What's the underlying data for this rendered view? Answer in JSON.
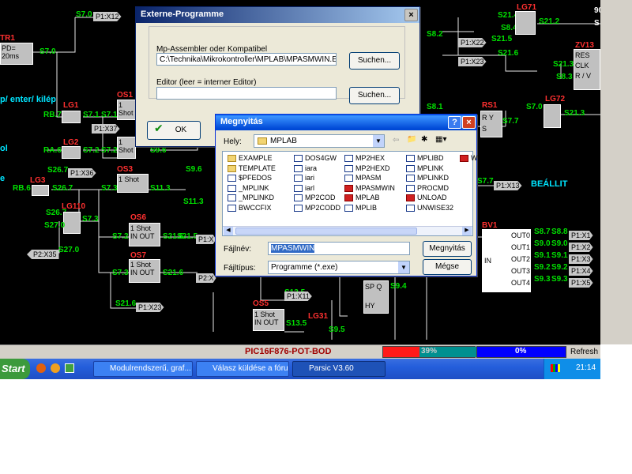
{
  "schematic": {
    "labels": [
      {
        "t": "S7.0",
        "c": "g"
      },
      {
        "t": "P1:X12",
        "c": "tag"
      },
      {
        "t": "TR1",
        "c": "r"
      },
      {
        "t": "PD=",
        "c": "k"
      },
      {
        "t": "20ms",
        "c": "k"
      },
      {
        "t": "S7.0",
        "c": "g"
      },
      {
        "t": "p/ enter/ kilép",
        "c": "c"
      },
      {
        "t": "LG1",
        "c": "r"
      },
      {
        "t": "RB.7",
        "c": "g"
      },
      {
        "t": "S7.1",
        "c": "g"
      },
      {
        "t": "OS1",
        "c": "r"
      },
      {
        "t": "S7.1",
        "c": "g"
      },
      {
        "t": "P1:X37",
        "c": "tag"
      },
      {
        "t": "ol",
        "c": "c"
      },
      {
        "t": "LG2",
        "c": "r"
      },
      {
        "t": "RA.6",
        "c": "g"
      },
      {
        "t": "S7.2",
        "c": "g"
      },
      {
        "t": "S7.2",
        "c": "g"
      },
      {
        "t": "S9.6",
        "c": "g"
      },
      {
        "t": "S26.7",
        "c": "g"
      },
      {
        "t": "P1:X36",
        "c": "tag"
      },
      {
        "t": "OS3",
        "c": "r"
      },
      {
        "t": "S9.6",
        "c": "g"
      },
      {
        "t": "e",
        "c": "c"
      },
      {
        "t": "LG3",
        "c": "r"
      },
      {
        "t": "RB.6",
        "c": "g"
      },
      {
        "t": "S26.7",
        "c": "g"
      },
      {
        "t": "S7.3",
        "c": "g"
      },
      {
        "t": "S11.3",
        "c": "g"
      },
      {
        "t": "LG110",
        "c": "r"
      },
      {
        "t": "S26.7",
        "c": "g"
      },
      {
        "t": "S7.3",
        "c": "g"
      },
      {
        "t": "S11.3",
        "c": "g"
      },
      {
        "t": "S27.0",
        "c": "g"
      },
      {
        "t": "OS6",
        "c": "r"
      },
      {
        "t": "P2:X35",
        "c": "tag"
      },
      {
        "t": "S27.0",
        "c": "g"
      },
      {
        "t": "S7.2",
        "c": "g"
      },
      {
        "t": "S21.5",
        "c": "g"
      },
      {
        "t": "S21.5",
        "c": "g"
      },
      {
        "t": "P1:X",
        "c": "tag"
      },
      {
        "t": "OS7",
        "c": "r"
      },
      {
        "t": "S7.3",
        "c": "g"
      },
      {
        "t": "S21.6",
        "c": "g"
      },
      {
        "t": "P2:X",
        "c": "tag"
      },
      {
        "t": "S21.6",
        "c": "g"
      },
      {
        "t": "P1:X23",
        "c": "tag"
      },
      {
        "t": "OS5",
        "c": "r"
      },
      {
        "t": "S13.5",
        "c": "g"
      },
      {
        "t": "P1:X11",
        "c": "tag"
      },
      {
        "t": "S13.5",
        "c": "g"
      },
      {
        "t": "LG31",
        "c": "r"
      },
      {
        "t": "S9.5",
        "c": "g"
      },
      {
        "t": "S9.4",
        "c": "g"
      },
      {
        "t": "S8.2",
        "c": "g"
      },
      {
        "t": "P1:X22",
        "c": "tag"
      },
      {
        "t": "S21.5",
        "c": "g"
      },
      {
        "t": "P1:X23",
        "c": "tag"
      },
      {
        "t": "S21.6",
        "c": "g"
      },
      {
        "t": "S21.4",
        "c": "g"
      },
      {
        "t": "S8.4",
        "c": "g"
      },
      {
        "t": "LG71",
        "c": "r"
      },
      {
        "t": "S21.2",
        "c": "g"
      },
      {
        "t": "ZV13",
        "c": "r"
      },
      {
        "t": "S21.3",
        "c": "g"
      },
      {
        "t": "S8.3",
        "c": "g"
      },
      {
        "t": "LG72",
        "c": "r"
      },
      {
        "t": "S7.0",
        "c": "g"
      },
      {
        "t": "S21.3",
        "c": "g"
      },
      {
        "t": "S8.1",
        "c": "g"
      },
      {
        "t": "RS1",
        "c": "r"
      },
      {
        "t": "S7.7",
        "c": "g"
      },
      {
        "t": "S7.7",
        "c": "g"
      },
      {
        "t": "P1:X13",
        "c": "tag"
      },
      {
        "t": "BEÁLLIT",
        "c": "c"
      },
      {
        "t": "BV1",
        "c": "r"
      },
      {
        "t": "900",
        "c": "w"
      },
      {
        "t": "S",
        "c": "w"
      }
    ],
    "blocks": {
      "one_shot": "1 Shot",
      "in": "IN",
      "out": "OUT",
      "pd": "PD=",
      "res": "RES",
      "clk": "CLK",
      "rv": "R / V",
      "sp": "SP",
      "hy": "HY",
      "q": "Q",
      "r": "R",
      "s": "S",
      "y": "Y"
    },
    "bv1": {
      "outs": [
        "OUT0",
        "OUT1",
        "OUT2",
        "OUT3",
        "OUT4"
      ],
      "s1": [
        "S8.7",
        "S9.0",
        "S9.1",
        "S9.2",
        "S9.3"
      ],
      "s2": [
        "S8.8",
        "S9.0",
        "S9.1",
        "S9.2",
        "S9.3"
      ],
      "ports": [
        "P1:X1",
        "P1:X2",
        "P1:X3",
        "P1:X4",
        "P1:X5"
      ],
      "in": "IN"
    }
  },
  "status_bar": {
    "device": "PIC16F876-POT-BOD",
    "progress_red": "39%",
    "progress_blue": "0%",
    "refresh": "Refresh",
    "progress_red_value": 39,
    "progress_blue_value": 0
  },
  "taskbar": {
    "start": "Start",
    "items": [
      "Modulrendszerű, graf...",
      "Válasz küldése a fóru...",
      "Parsic V3.60"
    ],
    "clock": "21:14",
    "colors": {
      "bar": "#245edb",
      "start": "#3c9a3c"
    }
  },
  "dialog_external": {
    "title": "Externe-Programme",
    "assembler_label": "Mp-Assembler oder Kompatibel",
    "assembler_path": "C:\\Technika\\Mikrokontroller\\MPLAB\\MPASMWIN.EXE",
    "search_btn": "Suchen...",
    "editor_label": "Editor (leer = interner Editor)",
    "editor_path": "",
    "search_btn2": "Suchen...",
    "ok": "OK"
  },
  "dialog_open": {
    "title": "Megnyitás",
    "location_label": "Hely:",
    "location": "MPLAB",
    "files": [
      [
        "EXAMPLE",
        "fold"
      ],
      [
        "TEMPLATE",
        "fold"
      ],
      [
        "$PFEDOS",
        "doc"
      ],
      [
        "_MPLINK",
        "doc"
      ],
      [
        "_MPLINKD",
        "doc"
      ],
      [
        "BWCCFIX",
        "doc"
      ],
      [
        "DOS4GW",
        "doc"
      ],
      [
        "iara",
        "doc"
      ],
      [
        "iari",
        "doc"
      ],
      [
        "iarl",
        "doc"
      ],
      [
        "MP2COD",
        "doc"
      ],
      [
        "MP2CODD",
        "doc"
      ],
      [
        "MP2HEX",
        "doc"
      ],
      [
        "MP2HEXD",
        "doc"
      ],
      [
        "MPASM",
        "doc"
      ],
      [
        "MPASMWIN",
        "red"
      ],
      [
        "MPLAB",
        "red"
      ],
      [
        "MPLIB",
        "doc"
      ],
      [
        "MPLIBD",
        "doc"
      ],
      [
        "MPLINK",
        "doc"
      ],
      [
        "MPLINKD",
        "doc"
      ],
      [
        "PROCMD",
        "doc"
      ],
      [
        "UNLOAD",
        "red"
      ],
      [
        "UNWISE32",
        "doc"
      ]
    ],
    "extra_file": "W",
    "filename_label": "Fájlnév:",
    "filename": "MPASMWIN",
    "open_btn": "Megnyitás",
    "filetype_label": "Fájltípus:",
    "filetype": "Programme (*.exe)",
    "cancel_btn": "Mégse"
  }
}
